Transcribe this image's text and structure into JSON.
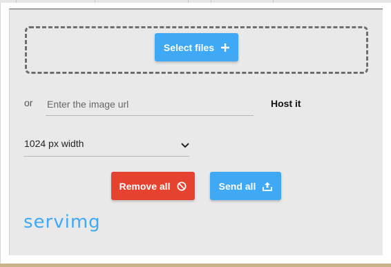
{
  "upload": {
    "select_files_label": "Select files",
    "or_label": "or",
    "url_placeholder": "Enter the image url",
    "url_value": "",
    "host_label": "Host it",
    "size_selected": "1024 px width",
    "remove_all_label": "Remove all",
    "send_all_label": "Send all"
  },
  "branding": {
    "logo_text": "servimg"
  },
  "icons": {
    "select": "plus-icon",
    "size": "chevron-down-icon",
    "remove": "ban-icon",
    "send": "upload-icon"
  },
  "colors": {
    "primary": "#3fa9f5",
    "danger": "#e5422f",
    "panel_bg": "#e9e9e9"
  }
}
